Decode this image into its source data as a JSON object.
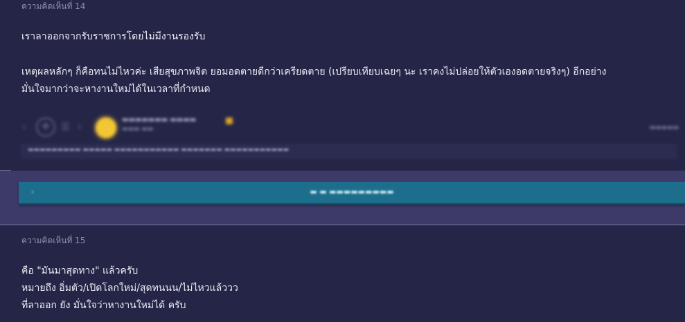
{
  "comment14": {
    "number": "ความคิดเห็นที่ 14",
    "lines": [
      "เราลาออกจากรับราชการโดยไม่มีงานรองรับ",
      "เหตุผลหลักๆ ก็คือทนไม่ไหวค่ะ เสียสุขภาพจิต ยอมอดตายดีกว่าเครียดตาย (เปรียบเทียบเฉยๆ นะ เราคงไม่ปล่อยให้ตัวเองอดตายจริงๆ) อีกอย่าง",
      "มั่นใจมากว่าจะหางานใหม่ได้ในเวลาที่กำหนด"
    ],
    "icons": [
      "chevron-left-icon",
      "plus-icon",
      "reaction-icon",
      "avatar",
      "badge-icon"
    ]
  },
  "reply": {
    "icon": "‹"
  },
  "colors": {
    "background": "#252647",
    "reply_panel": "#3d3a68",
    "reply_button": "#1d6e8c",
    "avatar": "#f2c634"
  },
  "comment15": {
    "number": "ความคิดเห็นที่ 15",
    "lines": [
      "คือ \"มันมาสุดทาง\"  แล้วครับ",
      "หมายถึง อิ่มตัว/เปิดโลกใหม่/สุดทนนน/ไม่ไหวแล้ววว",
      "ที่ลาออก ยัง มั่นใจว่าหางานใหม่ได้ ครับ"
    ]
  }
}
